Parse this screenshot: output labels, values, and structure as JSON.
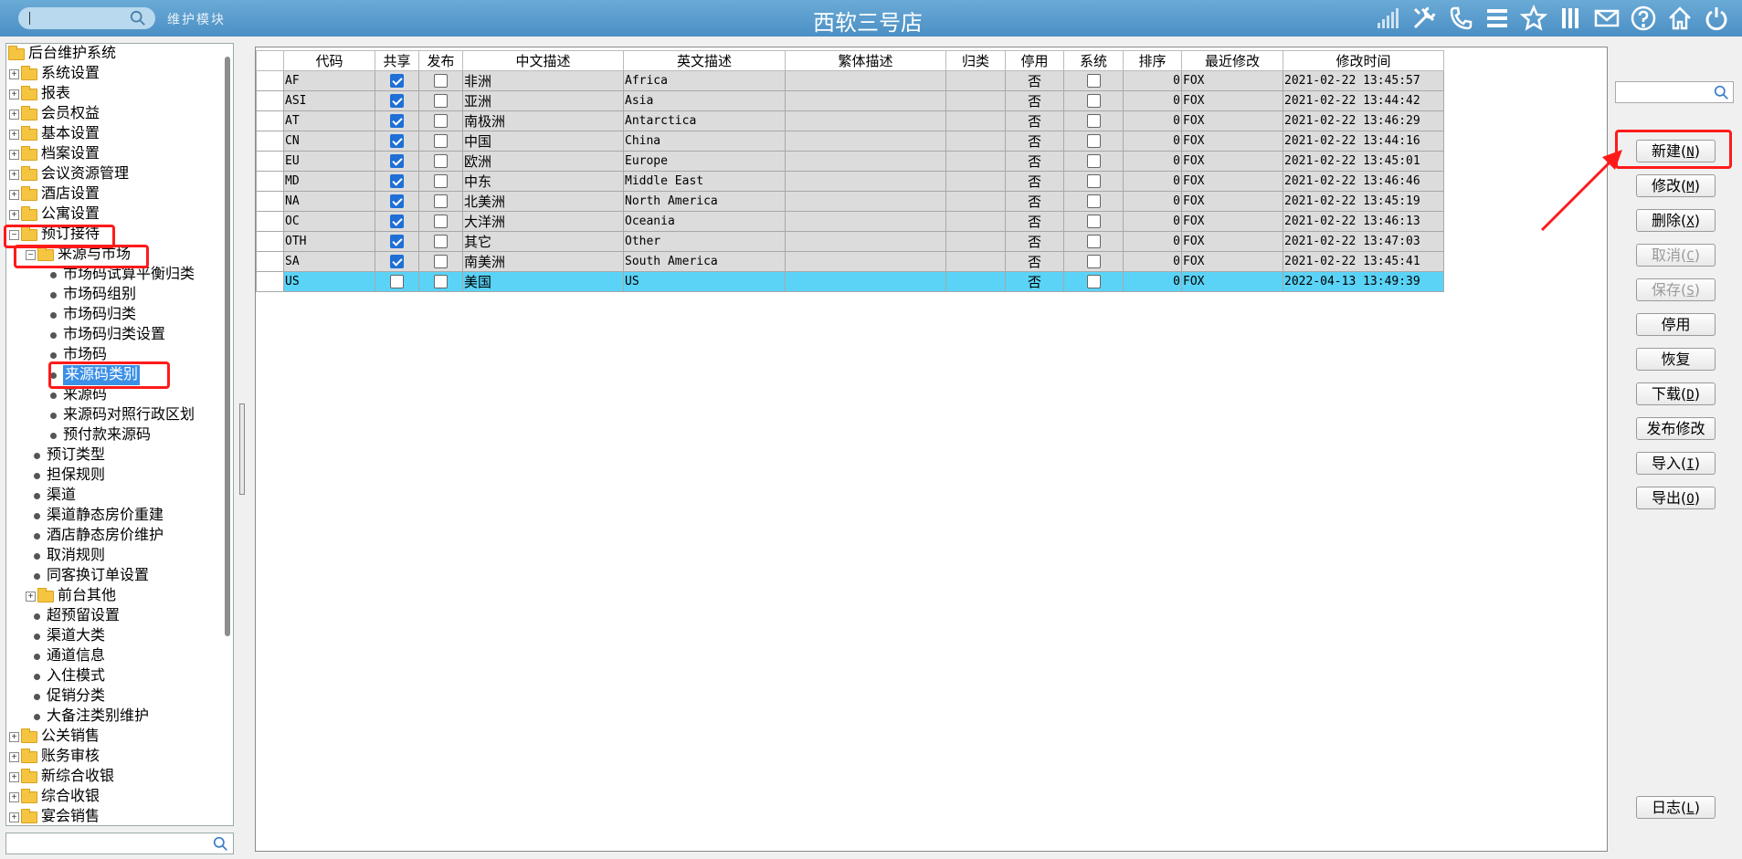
{
  "header": {
    "module_label": "维护模块",
    "title": "西软三号店"
  },
  "tree": {
    "root": "后台维护系统",
    "nodes": [
      {
        "label": "系统设置"
      },
      {
        "label": "报表"
      },
      {
        "label": "会员权益"
      },
      {
        "label": "基本设置"
      },
      {
        "label": "档案设置"
      },
      {
        "label": "会议资源管理"
      },
      {
        "label": "酒店设置"
      },
      {
        "label": "公寓设置"
      },
      {
        "label": "预订接待"
      },
      {
        "label": "来源与市场"
      },
      {
        "label": "市场码试算平衡归类"
      },
      {
        "label": "市场码组别"
      },
      {
        "label": "市场码归类"
      },
      {
        "label": "市场码归类设置"
      },
      {
        "label": "市场码"
      },
      {
        "label": "来源码类别"
      },
      {
        "label": "来源码"
      },
      {
        "label": "来源码对照行政区划"
      },
      {
        "label": "预付款来源码"
      },
      {
        "label": "预订类型"
      },
      {
        "label": "担保规则"
      },
      {
        "label": "渠道"
      },
      {
        "label": "渠道静态房价重建"
      },
      {
        "label": "酒店静态房价维护"
      },
      {
        "label": "取消规则"
      },
      {
        "label": "同客换订单设置"
      },
      {
        "label": "前台其他"
      },
      {
        "label": "超预留设置"
      },
      {
        "label": "渠道大类"
      },
      {
        "label": "通道信息"
      },
      {
        "label": "入住模式"
      },
      {
        "label": "促销分类"
      },
      {
        "label": "大备注类别维护"
      },
      {
        "label": "公关销售"
      },
      {
        "label": "账务审核"
      },
      {
        "label": "新综合收银"
      },
      {
        "label": "综合收银"
      },
      {
        "label": "宴会销售"
      }
    ]
  },
  "grid": {
    "columns": [
      "代码",
      "共享",
      "发布",
      "中文描述",
      "英文描述",
      "繁体描述",
      "归类",
      "停用",
      "系统",
      "排序",
      "最近修改",
      "修改时间"
    ],
    "rows": [
      {
        "code": "AF",
        "share": true,
        "publish": false,
        "zh": "非洲",
        "en": "Africa",
        "tw": "",
        "cat": "",
        "stop": "否",
        "sys": false,
        "order": "0",
        "modifier": "FOX",
        "time": "2021-02-22 13:45:57"
      },
      {
        "code": "ASI",
        "share": true,
        "publish": false,
        "zh": "亚洲",
        "en": "Asia",
        "tw": "",
        "cat": "",
        "stop": "否",
        "sys": false,
        "order": "0",
        "modifier": "FOX",
        "time": "2021-02-22 13:44:42"
      },
      {
        "code": "AT",
        "share": true,
        "publish": false,
        "zh": "南极洲",
        "en": "Antarctica",
        "tw": "",
        "cat": "",
        "stop": "否",
        "sys": false,
        "order": "0",
        "modifier": "FOX",
        "time": "2021-02-22 13:46:29"
      },
      {
        "code": "CN",
        "share": true,
        "publish": false,
        "zh": "中国",
        "en": "China",
        "tw": "",
        "cat": "",
        "stop": "否",
        "sys": false,
        "order": "0",
        "modifier": "FOX",
        "time": "2021-02-22 13:44:16"
      },
      {
        "code": "EU",
        "share": true,
        "publish": false,
        "zh": "欧洲",
        "en": "Europe",
        "tw": "",
        "cat": "",
        "stop": "否",
        "sys": false,
        "order": "0",
        "modifier": "FOX",
        "time": "2021-02-22 13:45:01"
      },
      {
        "code": "MD",
        "share": true,
        "publish": false,
        "zh": "中东",
        "en": "Middle East",
        "tw": "",
        "cat": "",
        "stop": "否",
        "sys": false,
        "order": "0",
        "modifier": "FOX",
        "time": "2021-02-22 13:46:46"
      },
      {
        "code": "NA",
        "share": true,
        "publish": false,
        "zh": "北美洲",
        "en": "North America",
        "tw": "",
        "cat": "",
        "stop": "否",
        "sys": false,
        "order": "0",
        "modifier": "FOX",
        "time": "2021-02-22 13:45:19"
      },
      {
        "code": "OC",
        "share": true,
        "publish": false,
        "zh": "大洋洲",
        "en": "Oceania",
        "tw": "",
        "cat": "",
        "stop": "否",
        "sys": false,
        "order": "0",
        "modifier": "FOX",
        "time": "2021-02-22 13:46:13"
      },
      {
        "code": "OTH",
        "share": true,
        "publish": false,
        "zh": "其它",
        "en": "Other",
        "tw": "",
        "cat": "",
        "stop": "否",
        "sys": false,
        "order": "0",
        "modifier": "FOX",
        "time": "2021-02-22 13:47:03"
      },
      {
        "code": "SA",
        "share": true,
        "publish": false,
        "zh": "南美洲",
        "en": "South America",
        "tw": "",
        "cat": "",
        "stop": "否",
        "sys": false,
        "order": "0",
        "modifier": "FOX",
        "time": "2021-02-22 13:45:41"
      },
      {
        "code": "US",
        "share": false,
        "publish": false,
        "zh": "美国",
        "en": "US",
        "tw": "",
        "cat": "",
        "stop": "否",
        "sys": false,
        "order": "0",
        "modifier": "FOX",
        "time": "2022-04-13 13:49:39",
        "selected": true
      }
    ]
  },
  "buttons": {
    "new": {
      "label": "新建",
      "accel": "N"
    },
    "edit": {
      "label": "修改",
      "accel": "M"
    },
    "delete": {
      "label": "删除",
      "accel": "X"
    },
    "cancel": {
      "label": "取消",
      "accel": "C"
    },
    "save": {
      "label": "保存",
      "accel": "S"
    },
    "disable": {
      "label": "停用"
    },
    "restore": {
      "label": "恢复"
    },
    "download": {
      "label": "下载",
      "accel": "D"
    },
    "publish": {
      "label": "发布修改"
    },
    "import": {
      "label": "导入",
      "accel": "I"
    },
    "export": {
      "label": "导出",
      "accel": "O"
    },
    "log": {
      "label": "日志",
      "accel": "L"
    }
  },
  "icons": {
    "header": [
      "signal-icon",
      "tools-icon",
      "phone-icon",
      "menu-icon",
      "star-icon",
      "columns-icon",
      "mail-icon",
      "help-icon",
      "home-icon",
      "power-icon"
    ]
  },
  "colors": {
    "header": "#4b8fc4",
    "selected_row": "#5ad3f6",
    "annotation": "#ff1a1a",
    "tree_selected": "#3b8fe6"
  }
}
